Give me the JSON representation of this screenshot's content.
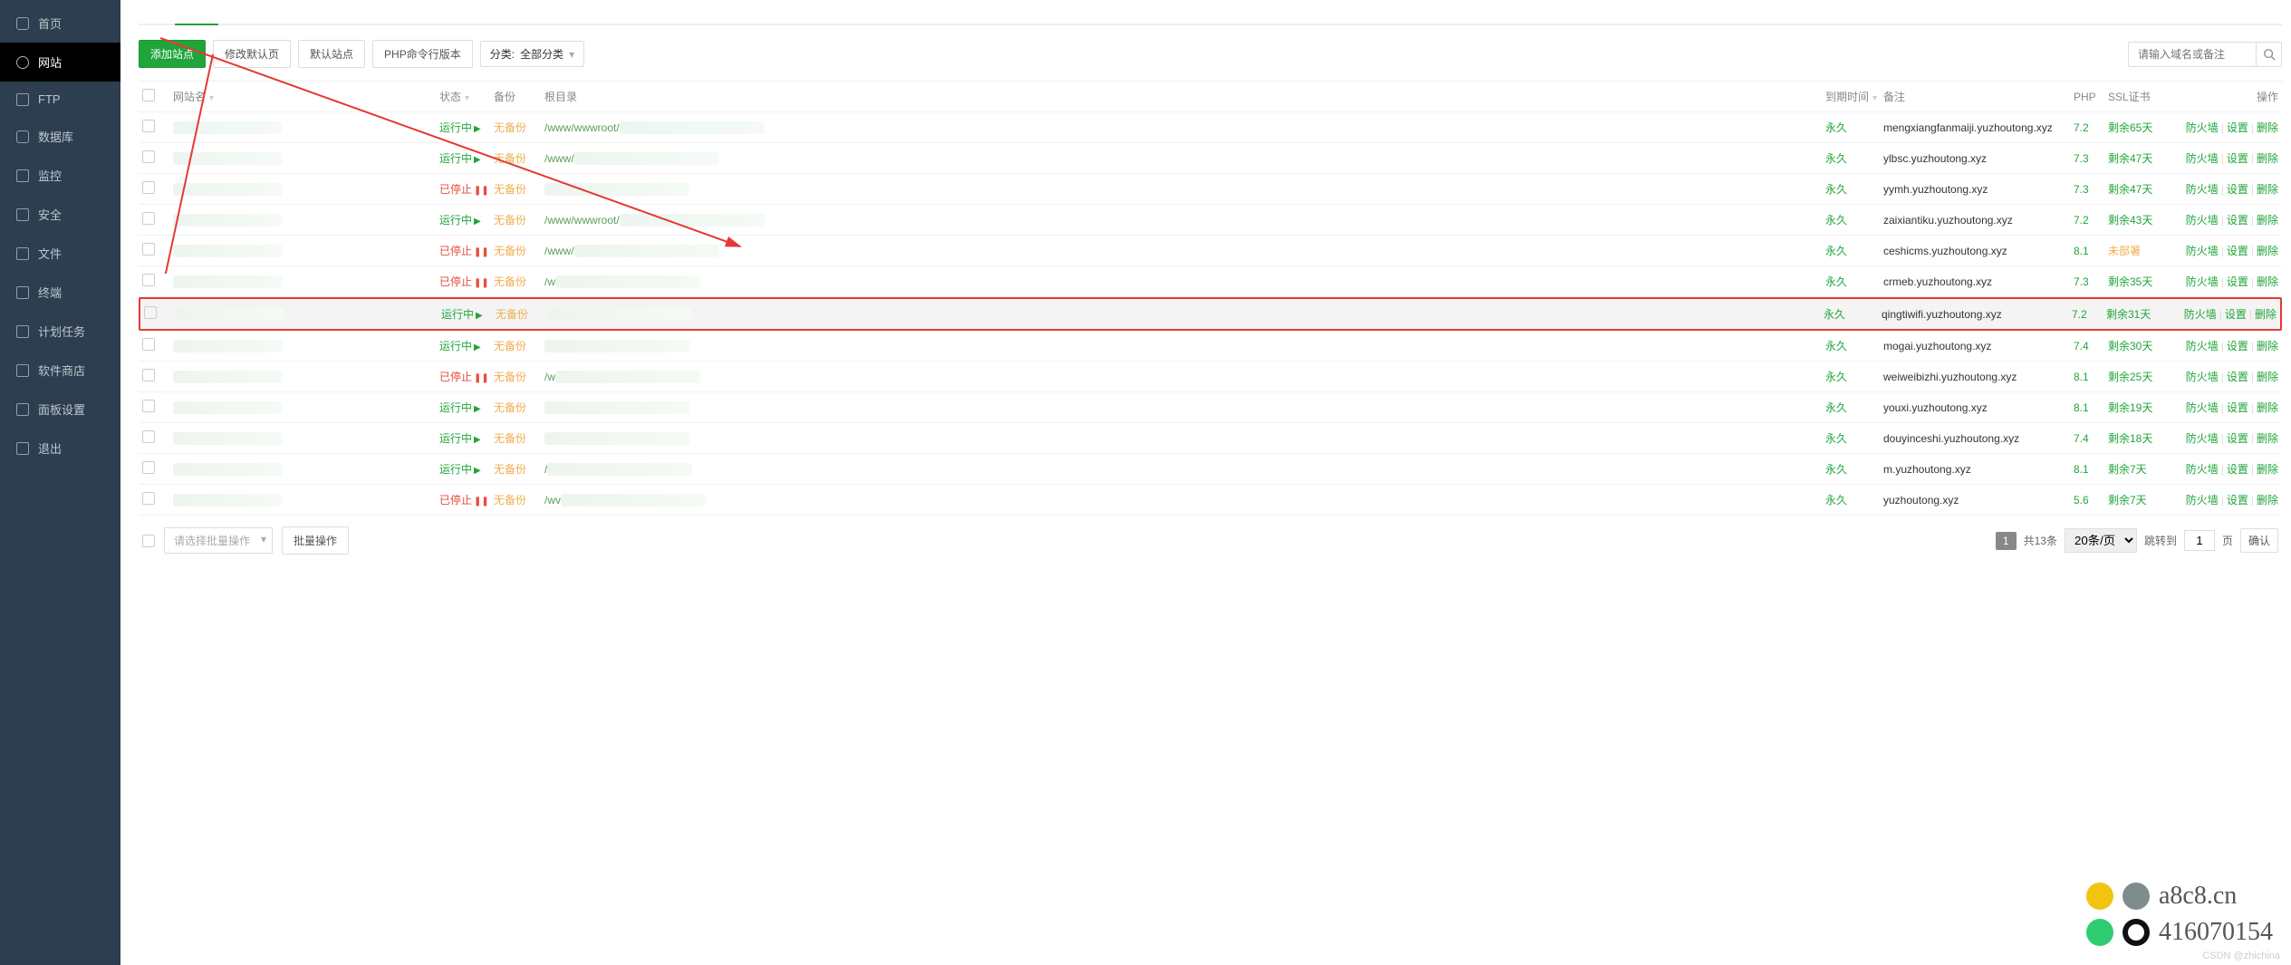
{
  "sidebar": [
    {
      "icon": "home",
      "label": "首页"
    },
    {
      "icon": "globe",
      "label": "网站",
      "active": true
    },
    {
      "icon": "ftp",
      "label": "FTP"
    },
    {
      "icon": "db",
      "label": "数据库"
    },
    {
      "icon": "mon",
      "label": "监控"
    },
    {
      "icon": "sec",
      "label": "安全"
    },
    {
      "icon": "file",
      "label": "文件"
    },
    {
      "icon": "term",
      "label": "终端"
    },
    {
      "icon": "cron",
      "label": "计划任务"
    },
    {
      "icon": "store",
      "label": "软件商店"
    },
    {
      "icon": "panel",
      "label": "面板设置"
    },
    {
      "icon": "exit",
      "label": "退出"
    }
  ],
  "toolbar": {
    "add": "添加站点",
    "modify_default": "修改默认页",
    "default_site": "默认站点",
    "php_cli": "PHP命令行版本",
    "cat_prefix": "分类:",
    "cat_value": "全部分类",
    "search_placeholder": "请输入域名或备注"
  },
  "headers": {
    "name": "网站名",
    "status": "状态",
    "backup": "备份",
    "root": "根目录",
    "expire": "到期时间",
    "note": "备注",
    "php": "PHP",
    "ssl": "SSL证书",
    "act": "操作"
  },
  "status_labels": {
    "running": "运行中",
    "stopped": "已停止"
  },
  "backup_label": "无备份",
  "expire_label": "永久",
  "actions": {
    "fw": "防火墙",
    "set": "设置",
    "del": "删除"
  },
  "rows": [
    {
      "status": "running",
      "root": "/www/wwwroot/",
      "note": "mengxiangfanmaiji.yuzhoutong.xyz",
      "php": "7.2",
      "ssl": "剩余65天",
      "ssl_state": "ok"
    },
    {
      "status": "running",
      "root": "/www/",
      "note": "ylbsc.yuzhoutong.xyz",
      "php": "7.3",
      "ssl": "剩余47天",
      "ssl_state": "ok"
    },
    {
      "status": "stopped",
      "root": "",
      "note": "yymh.yuzhoutong.xyz",
      "php": "7.3",
      "ssl": "剩余47天",
      "ssl_state": "ok"
    },
    {
      "status": "running",
      "root": "/www/wwwroot/",
      "note": "zaixiantiku.yuzhoutong.xyz",
      "php": "7.2",
      "ssl": "剩余43天",
      "ssl_state": "ok"
    },
    {
      "status": "stopped",
      "root": "/www/",
      "note": "ceshicms.yuzhoutong.xyz",
      "php": "8.1",
      "ssl": "未部署",
      "ssl_state": "warn"
    },
    {
      "status": "stopped",
      "root": "/w",
      "note": "crmeb.yuzhoutong.xyz",
      "php": "7.3",
      "ssl": "剩余35天",
      "ssl_state": "ok"
    },
    {
      "status": "running",
      "root": "",
      "note": "qingtiwifi.yuzhoutong.xyz",
      "php": "7.2",
      "ssl": "剩余31天",
      "ssl_state": "ok",
      "highlight": true
    },
    {
      "status": "running",
      "root": "",
      "note": "mogai.yuzhoutong.xyz",
      "php": "7.4",
      "ssl": "剩余30天",
      "ssl_state": "ok"
    },
    {
      "status": "stopped",
      "root": "/w",
      "note": "weiweibizhi.yuzhoutong.xyz",
      "php": "8.1",
      "ssl": "剩余25天",
      "ssl_state": "ok"
    },
    {
      "status": "running",
      "root": "",
      "note": "youxi.yuzhoutong.xyz",
      "php": "8.1",
      "ssl": "剩余19天",
      "ssl_state": "ok"
    },
    {
      "status": "running",
      "root": "",
      "note": "douyinceshi.yuzhoutong.xyz",
      "php": "7.4",
      "ssl": "剩余18天",
      "ssl_state": "ok"
    },
    {
      "status": "running",
      "root": "/",
      "note": "m.yuzhoutong.xyz",
      "php": "8.1",
      "ssl": "剩余7天",
      "ssl_state": "ok"
    },
    {
      "status": "stopped",
      "root": "/wv",
      "note": "yuzhoutong.xyz",
      "php": "5.6",
      "ssl": "剩余7天",
      "ssl_state": "ok"
    }
  ],
  "footer": {
    "batch_placeholder": "请选择批量操作",
    "batch_btn": "批量操作",
    "page_current": "1",
    "total": "共13条",
    "per_page": "20条/页",
    "jump_label": "跳转到",
    "jump_value": "1",
    "page_unit": "页",
    "confirm": "确认"
  },
  "watermark": {
    "line1": "a8c8.cn",
    "line2": "416070154",
    "csdn": "CSDN @zhichina"
  }
}
